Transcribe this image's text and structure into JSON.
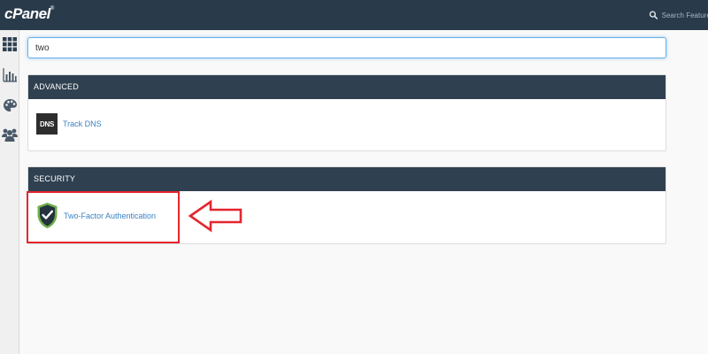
{
  "app": {
    "logo_text": "cPanel",
    "logo_mark": "®"
  },
  "header": {
    "search_placeholder": "Search Features"
  },
  "sidebar": {
    "items": [
      {
        "icon": "grid-icon"
      },
      {
        "icon": "bar-chart-icon"
      },
      {
        "icon": "palette-icon"
      },
      {
        "icon": "users-icon"
      }
    ]
  },
  "search": {
    "value": "two"
  },
  "sections": [
    {
      "title": "ADVANCED",
      "items": [
        {
          "label": "Track DNS",
          "icon_text": "DNS"
        }
      ]
    },
    {
      "title": "SECURITY",
      "items": [
        {
          "label": "Two-Factor Authentication"
        }
      ]
    }
  ],
  "colors": {
    "topbar": "#293a4a",
    "panel_header": "#2f4050",
    "link": "#3a82c4",
    "highlight": "#e4262d"
  }
}
